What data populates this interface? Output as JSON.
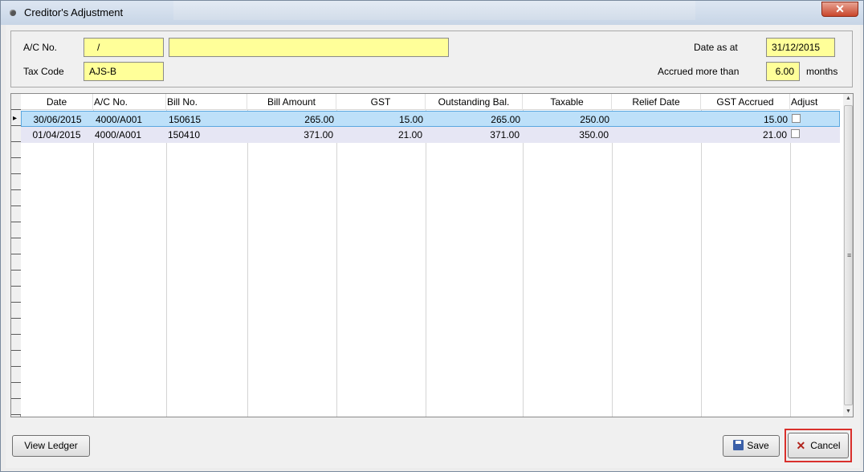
{
  "window": {
    "title": "Creditor's Adjustment",
    "close_glyph": "✕"
  },
  "header": {
    "ac_label": "A/C No.",
    "ac_value": "/",
    "ac_name_value": "",
    "tax_label": "Tax Code",
    "tax_value": "AJS-B",
    "date_label": "Date as at",
    "date_value": "31/12/2015",
    "accrued_label": "Accrued more than",
    "accrued_value": "6.00",
    "months_label": "months"
  },
  "grid": {
    "columns": [
      "Date",
      "A/C No.",
      "Bill No.",
      "Bill Amount",
      "GST",
      "Outstanding Bal.",
      "Taxable",
      "Relief Date",
      "GST Accrued",
      "Adjust"
    ],
    "rows": [
      {
        "date": "30/06/2015",
        "ac": "4000/A001",
        "bill": "150615",
        "amount": "265.00",
        "gst": "15.00",
        "outstanding": "265.00",
        "taxable": "250.00",
        "relief": "",
        "gst_accrued": "15.00",
        "adjust": false
      },
      {
        "date": "01/04/2015",
        "ac": "4000/A001",
        "bill": "150410",
        "amount": "371.00",
        "gst": "21.00",
        "outstanding": "371.00",
        "taxable": "350.00",
        "relief": "",
        "gst_accrued": "21.00",
        "adjust": false
      }
    ],
    "row_indicator": "▸"
  },
  "footer": {
    "view_ledger_label": "View Ledger",
    "save_label": "Save",
    "cancel_label": "Cancel"
  },
  "icons": {
    "save": "floppy-disk-icon",
    "cancel": "x-icon"
  },
  "colors": {
    "input_yellow": "#ffff99",
    "selection_blue": "#bde0f9",
    "focus_red": "#d9302c"
  }
}
